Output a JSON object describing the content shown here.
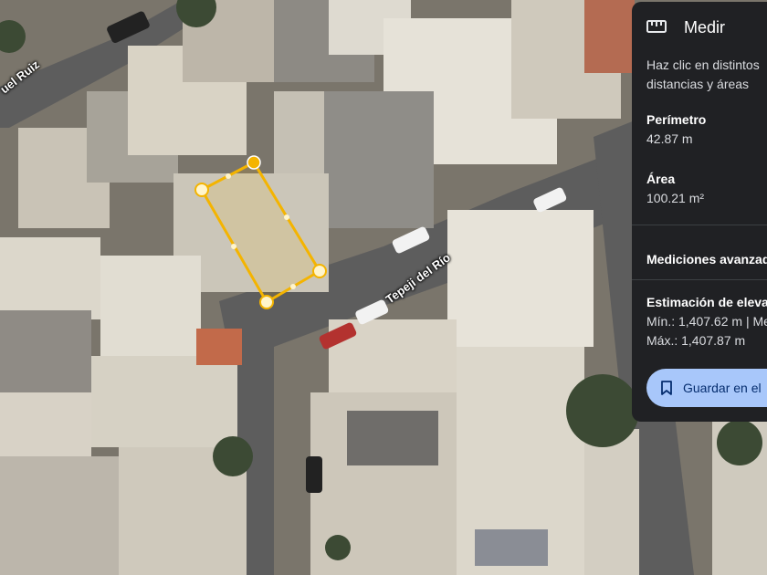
{
  "map": {
    "streets": [
      {
        "id": "manuel-ruiz",
        "label": "uel Ruiz"
      },
      {
        "id": "tepeji-del-rio",
        "label": "Tepeji del Río"
      }
    ],
    "measure_shape_color": "#f4b400",
    "vertex_count": 4
  },
  "panel": {
    "icon": "ruler-icon",
    "title": "Medir",
    "instruction_line1": "Haz clic en distintos",
    "instruction_line2": "distancias y áreas",
    "perimeter_label": "Perímetro",
    "perimeter_value": "42.87 m",
    "area_label": "Área",
    "area_value": "100.21 m²",
    "advanced_label": "Mediciones avanzad",
    "elevation_label": "Estimación de eleva",
    "elevation_min": "Mín.: 1,407.62 m | Me",
    "elevation_max": "Máx.: 1,407.87 m",
    "save_button_label": "Guardar en el",
    "save_icon": "bookmark-icon"
  },
  "colors": {
    "panel_bg": "#202124",
    "button_bg": "#a8c7fa",
    "button_text": "#062e6f",
    "measure_line": "#f4b400"
  }
}
